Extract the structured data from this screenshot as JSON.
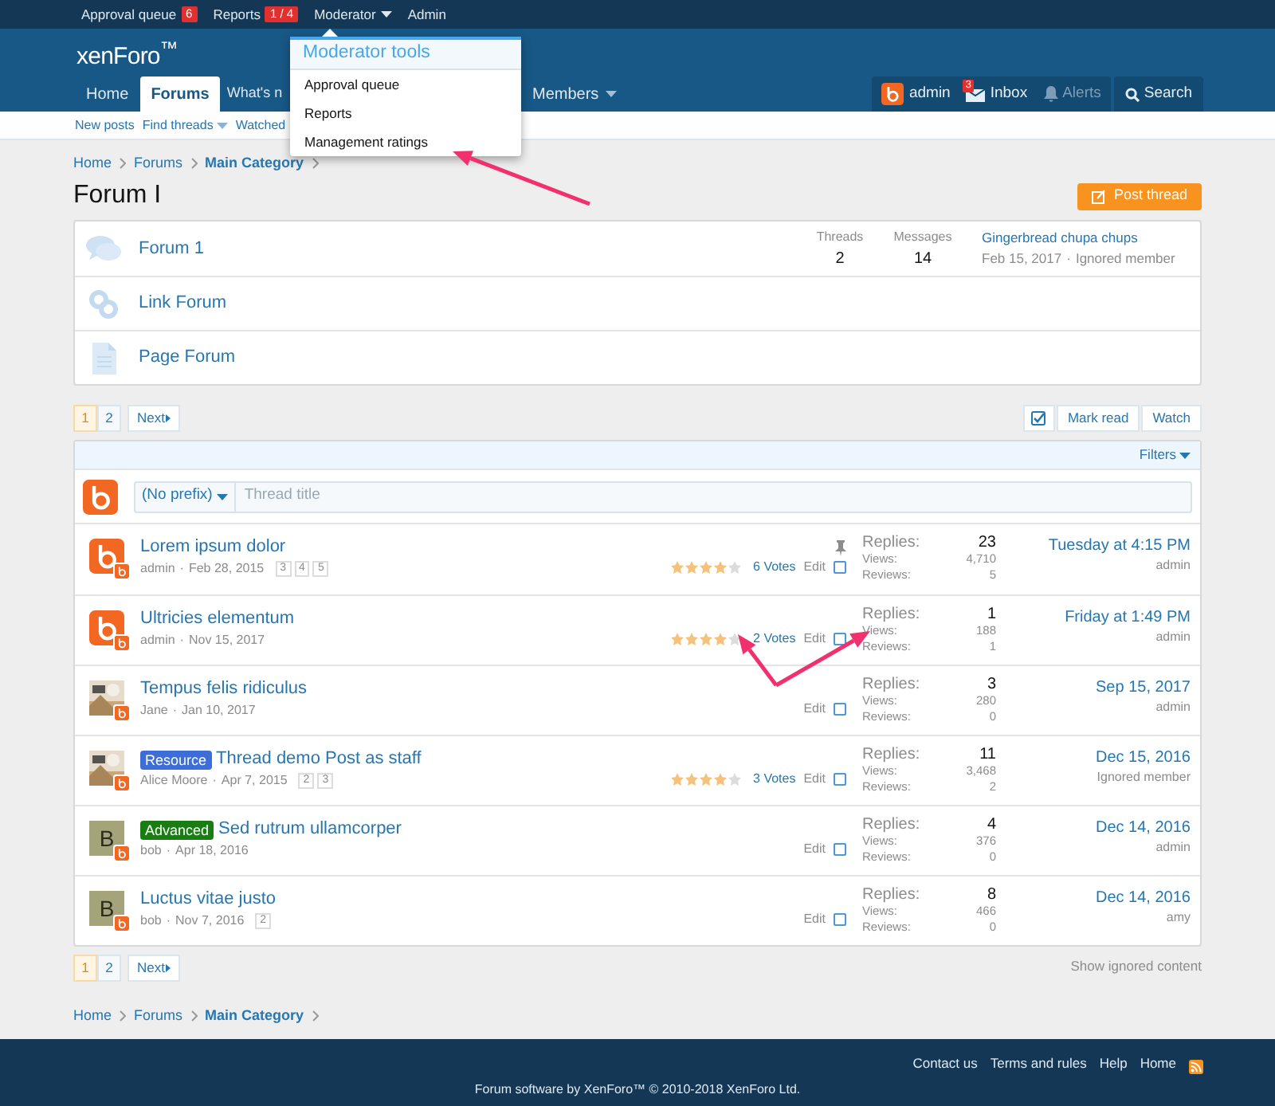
{
  "top_bar": {
    "items": [
      {
        "label": "Approval queue",
        "badge": "6",
        "dropdown": false
      },
      {
        "label": "Reports",
        "badge": "1 / 4",
        "dropdown": false
      },
      {
        "label": "Moderator",
        "dropdown": true
      },
      {
        "label": "Admin",
        "dropdown": false
      }
    ]
  },
  "logo": "xenForo$^{™}$",
  "nav": {
    "tabs": [
      {
        "label": "Home",
        "selected": false,
        "dropdown": false
      },
      {
        "label": "Forums",
        "selected": true,
        "dropdown": false
      },
      {
        "label": "What's n",
        "selected": false,
        "dropdown": false
      },
      {
        "label": "Members",
        "selected": false,
        "dropdown": true
      }
    ]
  },
  "user_nav": [
    {
      "kind": "avatar",
      "label": "admin",
      "disabled": false
    },
    {
      "kind": "inbox",
      "label": "Inbox",
      "badge": "3",
      "disabled": false
    },
    {
      "kind": "alerts",
      "label": "Alerts",
      "disabled": true
    },
    {
      "kind": "search",
      "label": "Search",
      "disabled": false
    }
  ],
  "sub_nav": [
    {
      "label": "New posts",
      "dropdown": false
    },
    {
      "label": "Find threads",
      "dropdown": true
    },
    {
      "label": "Watched",
      "dropdown": false
    }
  ],
  "moderator_menu": {
    "title": "Moderator tools",
    "items": [
      "Approval queue",
      "Reports",
      "Management ratings"
    ]
  },
  "breadcrumb": [
    "Home",
    "Forums",
    "Main Category"
  ],
  "page_title": "Forum I",
  "post_button": "Post thread",
  "forums": [
    {
      "kind": "forum",
      "name": "Forum 1",
      "threads_label": "Threads",
      "threads": "2",
      "messages_label": "Messages",
      "messages": "14",
      "last_title": "Gingerbread chupa chups",
      "last_date": "Feb 15, 2017",
      "separator": "·",
      "last_user": "Ignored member"
    },
    {
      "kind": "link",
      "name": "Link Forum"
    },
    {
      "kind": "page",
      "name": "Page Forum"
    }
  ],
  "pagination": {
    "pages": [
      {
        "label": "1",
        "selected": true
      },
      {
        "label": "2",
        "selected": false
      }
    ],
    "next": "Next"
  },
  "list_actions": [
    "Mark read",
    "Watch"
  ],
  "filters": "Filters",
  "quick_thread": {
    "prefix": "(No prefix)",
    "placeholder": "Thread title"
  },
  "threads": [
    {
      "avatar": {
        "kind": "logo"
      },
      "title": "Lorem ipsum dolor",
      "pinned": true,
      "selected": false,
      "author": "admin",
      "separator": "·",
      "date": "Feb 28, 2015",
      "pages": [
        "3",
        "4",
        "5"
      ],
      "stars": 4,
      "votes": "6 Votes",
      "edit": "Edit",
      "replies_label": "Replies:",
      "replies": "23",
      "views_label": "Views:",
      "views": "4,710",
      "reviews_label": "Reviews:",
      "reviews": "5",
      "last_date": "Tuesday at 4:15 PM",
      "last_user": "admin"
    },
    {
      "avatar": {
        "kind": "logo"
      },
      "title": "Ultricies elementum",
      "pinned": false,
      "selected": false,
      "author": "admin",
      "separator": "·",
      "date": "Nov 15, 2017",
      "stars": 4,
      "votes": "2 Votes",
      "edit": "Edit",
      "replies_label": "Replies:",
      "replies": "1",
      "views_label": "Views:",
      "views": "188",
      "reviews_label": "Reviews:",
      "reviews": "1",
      "last_date": "Friday at 1:49 PM",
      "last_user": "admin"
    },
    {
      "avatar": {
        "kind": "picture"
      },
      "title": "Tempus felis ridiculus",
      "pinned": false,
      "selected": false,
      "author": "Jane",
      "separator": "·",
      "date": "Jan 10, 2017",
      "edit": "Edit",
      "replies_label": "Replies:",
      "replies": "3",
      "views_label": "Views:",
      "views": "280",
      "reviews_label": "Reviews:",
      "reviews": "0",
      "last_date": "Sep 15, 2017",
      "last_user": "admin"
    },
    {
      "avatar": {
        "kind": "picture"
      },
      "prefix": {
        "label": "Resource",
        "color": "#3d6ed8"
      },
      "title": "Thread demo Post as staff",
      "pinned": false,
      "selected": false,
      "author": "Alice Moore",
      "separator": "·",
      "date": "Apr 7, 2015",
      "pages": [
        "2",
        "3"
      ],
      "stars": 4,
      "votes": "3 Votes",
      "edit": "Edit",
      "replies_label": "Replies:",
      "replies": "11",
      "views_label": "Views:",
      "views": "3,468",
      "reviews_label": "Reviews:",
      "reviews": "2",
      "last_date": "Dec 15, 2016",
      "last_user": "Ignored member"
    },
    {
      "avatar": {
        "kind": "letter",
        "letter": "B"
      },
      "prefix": {
        "label": "Advanced",
        "color": "#1a7d13"
      },
      "title": "Sed rutrum ullamcorper",
      "pinned": false,
      "selected": false,
      "author": "bob",
      "separator": "·",
      "date": "Apr 18, 2016",
      "edit": "Edit",
      "replies_label": "Replies:",
      "replies": "4",
      "views_label": "Views:",
      "views": "376",
      "reviews_label": "Reviews:",
      "reviews": "0",
      "last_date": "Dec 14, 2016",
      "last_user": "admin"
    },
    {
      "avatar": {
        "kind": "letter",
        "letter": "B"
      },
      "title": "Luctus vitae justo",
      "pinned": false,
      "selected": false,
      "author": "bob",
      "separator": "·",
      "date": "Nov 7, 2016",
      "pages": [
        "2"
      ],
      "edit": "Edit",
      "replies_label": "Replies:",
      "replies": "8",
      "views_label": "Views:",
      "views": "466",
      "reviews_label": "Reviews:",
      "reviews": "0",
      "last_date": "Dec 14, 2016",
      "last_user": "amy"
    }
  ],
  "bottom_pagination": {
    "pages": [
      {
        "label": "1",
        "selected": true
      },
      {
        "label": "2",
        "selected": false
      }
    ],
    "next": "Next"
  },
  "show_ignored": "Show ignored content",
  "bottom_breadcrumb": [
    "Home",
    "Forums",
    "Main Category"
  ],
  "footer": {
    "links": [
      "Contact us",
      "Terms and rules",
      "Help",
      "Home"
    ],
    "copyright": "Forum software by XenForo™ © 2010-2018 XenForo Ltd."
  }
}
